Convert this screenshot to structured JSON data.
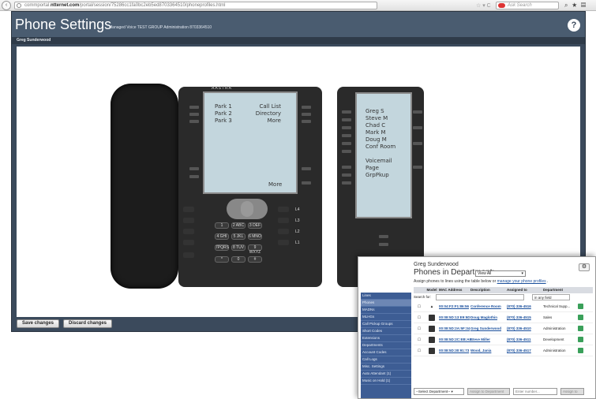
{
  "browser": {
    "url_prefix": "commportal.",
    "url_bold": "ntternet.com",
    "url_rest": "/portal/session/75286cc1fa0bc2eb5ed8703364510/phoneprofiles.html",
    "search_placeholder": "Ask Search"
  },
  "app": {
    "title": "Phone Settings",
    "subtitle": "Managed Voice TEST GROUP Administration 8703364510",
    "help": "?",
    "user": "Greg Sunderwood"
  },
  "phone": {
    "brand": "AASTRA",
    "lcd_left": [
      "Park 1",
      "Park 2",
      "Park 3"
    ],
    "lcd_right": [
      "Call List",
      "Directory",
      "More"
    ],
    "lcd_more": "More",
    "keys": [
      [
        "1",
        "2 ABC",
        "3 DEF"
      ],
      [
        "4 GHI",
        "5 JKL",
        "6 MNO"
      ],
      [
        "7PQRS",
        "8 TUV",
        "9 WXYZ"
      ],
      [
        "*",
        "0",
        "#"
      ]
    ],
    "line_keys": [
      "L4",
      "L3",
      "L2",
      "L1"
    ],
    "expansion": [
      "Greg S",
      "Steve M",
      "Chad C",
      "Mark M",
      "Doug M",
      "Conf Room",
      "",
      "Voicemail",
      "Page",
      "GrpPkup"
    ]
  },
  "footer": {
    "save": "Save changes",
    "discard": "Discard changes"
  },
  "overlay": {
    "user": "Greg Sunderwood",
    "heading": "Phones in Department:",
    "dept_value": "View All",
    "assign_text": "Assign phones to lines using the table below or ",
    "assign_link": "manage your phone profiles",
    "assign_end": " .",
    "gear": "⚙",
    "sidebar": [
      "Lines",
      "Phones",
      "MADNs",
      "MLHGs",
      "Call Pickup Groups",
      "Short Codes",
      "Extensions",
      "Departments",
      "Account Codes",
      "Call Logs",
      "Misc. Settings",
      "Auto Attendant (1)",
      "Music on Hold (1)"
    ],
    "columns": [
      "",
      "Model",
      "MAC Address",
      "Description",
      "Assigned to",
      "Department"
    ],
    "search_label": "Search for:",
    "search_field": "in any field",
    "rows": [
      {
        "mac": "00:04:F2:F1:86:56",
        "desc": "Conference Room",
        "assigned": "(870) 336-4516",
        "dept": "Technical Supp..."
      },
      {
        "mac": "00:08:5D:13:E9:5D",
        "desc": "Doug Maglothin",
        "assigned": "(870) 336-4515",
        "dept": "Sales"
      },
      {
        "mac": "00:08:5D:2A:5F:34",
        "desc": "Greg Sunderwood",
        "assigned": "(870) 336-4510",
        "dept": "Administration"
      },
      {
        "mac": "00:08:5D:2C:EB:A8",
        "desc": "Steve Miller",
        "assigned": "(870) 336-4511",
        "dept": "Development"
      },
      {
        "mac": "00:08:5D:30:91:73",
        "desc": "Wood, Jania",
        "assigned": "(870) 336-4517",
        "dept": "Administration"
      }
    ],
    "footer": {
      "select_dept": "--Select Department--",
      "assign_dept": "Assign to Department",
      "enter_number": "Enter number...",
      "assign_to": "Assign to"
    }
  }
}
